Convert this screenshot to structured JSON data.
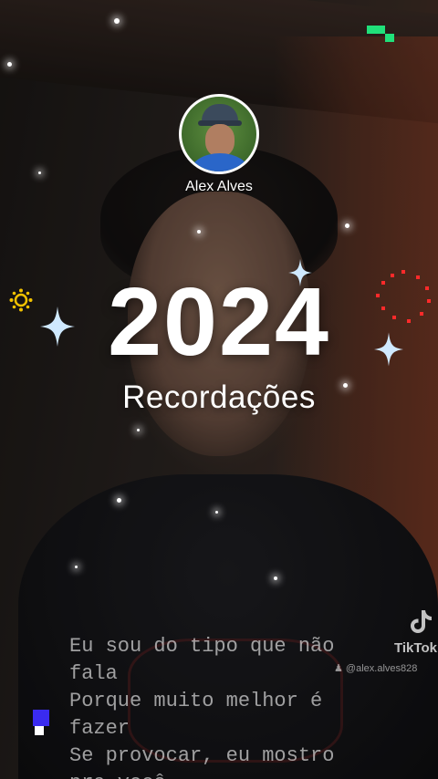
{
  "profile": {
    "name": "Alex Alves"
  },
  "title": {
    "year": "2024",
    "subtitle": "Recordações"
  },
  "lyrics": [
    "Eu sou do tipo que não",
    "fala",
    "Porque muito melhor é",
    "fazer",
    "Se provocar, eu mostro",
    "pra você"
  ],
  "watermark": {
    "brand": "TikTok",
    "handle": "@alex.alves828"
  },
  "icons": {
    "avatar": "profile-photo",
    "sparkles": "four-point-star-icon",
    "sun": "sun-ring-icon",
    "dotted-heart": "dotted-circle-icon",
    "tiktok": "tiktok-note-icon",
    "user": "user-icon"
  },
  "colors": {
    "text": "#ffffff",
    "sparkle": "#cfe9ff",
    "accent_green": "#20e07a",
    "accent_blue": "#3a2bf0",
    "accent_yellow": "#f2c200",
    "accent_red": "#ff2a2a"
  }
}
